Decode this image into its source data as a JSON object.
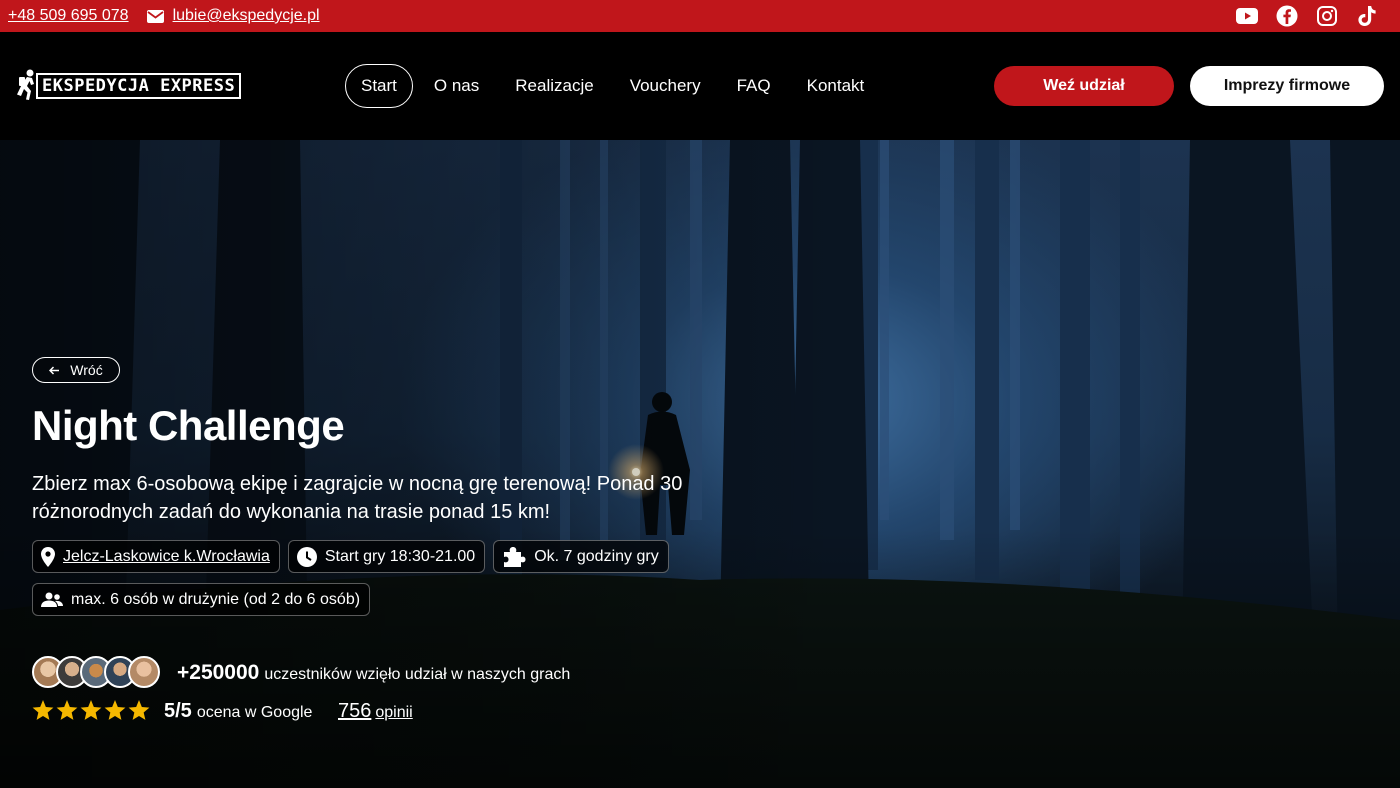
{
  "topbar": {
    "phone": "+48 509 695 078",
    "email": "lubie@ekspedycje.pl",
    "socials": [
      "youtube-icon",
      "facebook-icon",
      "instagram-icon",
      "tiktok-icon"
    ]
  },
  "header": {
    "logo_text": "EKSPEDYCJA EXPRESS",
    "nav": [
      "Start",
      "O nas",
      "Realizacje",
      "Vouchery",
      "FAQ",
      "Kontakt"
    ],
    "cta_primary": "Weź udział",
    "cta_secondary": "Imprezy firmowe"
  },
  "hero": {
    "back_label": "Wróć",
    "title": "Night Challenge",
    "description": "Zbierz max 6-osobową ekipę i zagrajcie w nocną grę terenową! Ponad 30 różnorodnych zadań do wykonania na trasie ponad 15 km!",
    "location": "Jelcz-Laskowice k.Wrocławia",
    "start_time": "Start gry 18:30-21.00",
    "duration": "Ok. 7 godziny gry",
    "team_size": "max. 6 osób w drużynie (od 2 do 6 osób)",
    "participants_count": "+250000",
    "participants_text": "uczestników wzięło udział w naszych grach",
    "rating": "5/5",
    "rating_text": "ocena w Google",
    "reviews_count": "756",
    "reviews_text": "opinii",
    "stars": 5
  },
  "colors": {
    "brand_red": "#c0161b",
    "star": "#f5b800"
  }
}
